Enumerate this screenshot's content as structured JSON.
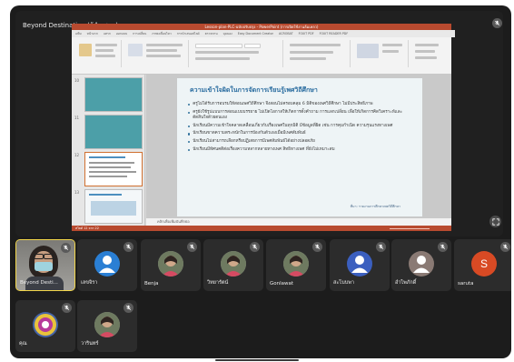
{
  "window": {
    "background": "#1c1c1c",
    "screen_share_label": "Beyond Destination (ผู้นำเสนอ)"
  },
  "presentation": {
    "window_title": "Lesson-plan-PLC-ฉบับปรับปรุง - PowerPoint (การเปิดใช้งานล้มเหลว)",
    "ribbon_tabs": [
      "แฟ้ม",
      "หน้าแรก",
      "แทรก",
      "ออกแบบ",
      "การเปลี่ยน",
      "ภาพเคลื่อนไหว",
      "การนำเสนอสไลด์",
      "ตรวจทาน",
      "มุมมอง",
      "Easy Document Creator",
      "ACROBAT",
      "FOXIT PDF",
      "FOXIT READER PDF"
    ],
    "thumbnail_numbers": [
      "10",
      "11",
      "12",
      "13"
    ],
    "slide": {
      "title": "ความเข้าใจผิดในการจัดการเรียนรู้เพศวิถีศึกษา",
      "bullets": [
        "ครูไม่ได้รับการอบรมให้สอนเพศวิถีศึกษา จึงสอนไม่ครอบคลุม 6 มิติของเพศวิถีศึกษา ไม่มีประสิทธิภาพ",
        "ครูยังใช้รูปแบบการสอนแบบบรรยาย ไม่เปิดโอกาสให้เกิดการตั้งคำถาม การแลกเปลี่ยน เพื่อให้เกิดการคิดวิเคราะห์และตัดสินใจด้วยตนเอง",
        "นักเรียนมีความเข้าใจคลาดเคลื่อนเกี่ยวกับเรื่องเพศในทุกมิติ มีข้อมูลที่ผิด เช่น การคุมกำเนิด ความรุนแรงทางเพศ",
        "นักเรียนขาดความตระหนักในการป้องกันตัวเองเมื่อมีเพศสัมพันธ์",
        "นักเรียนไม่สามารถเลือกหรือปฏิเสธการมีเพศสัมพันธ์ได้อย่างปลอดภัย",
        "นักเรียนมีทัศนคติต่อเรื่องความหลากหลายทางเพศ สิทธิทางเพศ ที่ยังไม่เหมาะสม"
      ],
      "source": "ที่มา: รายงานการศึกษาเพศวิถีศึกษา"
    },
    "notes_placeholder": "คลิกเพื่อเพิ่มบันทึกย่อ",
    "status_text": "สไลด์ 12 จาก 22",
    "accent": "#b84a2f"
  },
  "participants": [
    {
      "name": "Beyond Desti...",
      "kind": "video",
      "speaking": true
    },
    {
      "name": "เลขจิรา",
      "kind": "avatar",
      "avatar_color": "#2a7fd4"
    },
    {
      "name": "Benja",
      "kind": "photo"
    },
    {
      "name": "วิทยารัตน์",
      "kind": "photo"
    },
    {
      "name": "Gonlawat",
      "kind": "photo"
    },
    {
      "name": "สะโบบพา",
      "kind": "avatar",
      "avatar_color": "#3b5fbf"
    },
    {
      "name": "อำไพภักดิ์",
      "kind": "avatar",
      "avatar_color": "#8a7a74"
    },
    {
      "name": "saruta",
      "kind": "initial",
      "initial": "S",
      "avatar_color": "#d84a24"
    },
    {
      "name": "คุณ",
      "kind": "logo"
    },
    {
      "name": "วารินทร์",
      "kind": "photo"
    }
  ]
}
